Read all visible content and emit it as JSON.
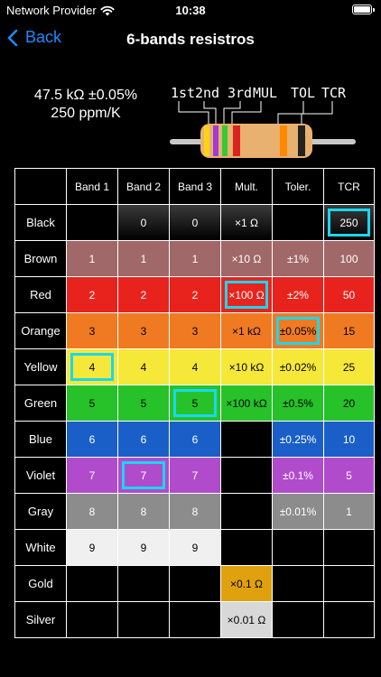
{
  "status": {
    "carrier": "Network Provider",
    "time": "10:38"
  },
  "nav": {
    "back_label": "Back",
    "title": "6-bands resistros"
  },
  "summary": {
    "line1": "47.5 kΩ ±0.05%",
    "line2": "250 ppm/K"
  },
  "diagram": {
    "labels": [
      "1st",
      "2nd",
      "3rd",
      "MUL",
      "TOL",
      "TCR"
    ],
    "bands": [
      "#ffd21a",
      "#a23bd6",
      "#33cc33",
      "#dd2222",
      "#ff8800",
      "#222222"
    ]
  },
  "table": {
    "headers": [
      "",
      "Band 1",
      "Band 2",
      "Band 3",
      "Mult.",
      "Toler.",
      "TCR"
    ],
    "rows": [
      {
        "name": "Black",
        "bg": "#1a1a1a",
        "text": "#ffffff",
        "values": [
          "",
          "0",
          "0",
          "×1 Ω",
          "",
          "250"
        ],
        "filled": [
          false,
          true,
          true,
          true,
          false,
          true
        ],
        "selected": [
          false,
          false,
          false,
          false,
          false,
          true
        ]
      },
      {
        "name": "Brown",
        "bg": "#a06868",
        "text": "#ffffff",
        "values": [
          "1",
          "1",
          "1",
          "×10 Ω",
          "±1%",
          "100"
        ],
        "filled": [
          true,
          true,
          true,
          true,
          true,
          true
        ],
        "selected": [
          false,
          false,
          false,
          false,
          false,
          false
        ]
      },
      {
        "name": "Red",
        "bg": "#e8231e",
        "text": "#ffffff",
        "values": [
          "2",
          "2",
          "2",
          "×100 Ω",
          "±2%",
          "50"
        ],
        "filled": [
          true,
          true,
          true,
          true,
          true,
          true
        ],
        "selected": [
          false,
          false,
          false,
          true,
          false,
          false
        ]
      },
      {
        "name": "Orange",
        "bg": "#f07a22",
        "text": "#000000",
        "values": [
          "3",
          "3",
          "3",
          "×1 kΩ",
          "±0.05%",
          "15"
        ],
        "filled": [
          true,
          true,
          true,
          true,
          true,
          true
        ],
        "selected": [
          false,
          false,
          false,
          false,
          true,
          false
        ]
      },
      {
        "name": "Yellow",
        "bg": "#f5e838",
        "text": "#000000",
        "values": [
          "4",
          "4",
          "4",
          "×10 kΩ",
          "±0.02%",
          "25"
        ],
        "filled": [
          true,
          true,
          true,
          true,
          true,
          true
        ],
        "selected": [
          true,
          false,
          false,
          false,
          false,
          false
        ]
      },
      {
        "name": "Green",
        "bg": "#27c22a",
        "text": "#000000",
        "values": [
          "5",
          "5",
          "5",
          "×100 kΩ",
          "±0.5%",
          "20"
        ],
        "filled": [
          true,
          true,
          true,
          true,
          true,
          true
        ],
        "selected": [
          false,
          false,
          true,
          false,
          false,
          false
        ]
      },
      {
        "name": "Blue",
        "bg": "#1a5fc8",
        "text": "#ffffff",
        "values": [
          "6",
          "6",
          "6",
          "",
          "±0.25%",
          "10"
        ],
        "filled": [
          true,
          true,
          true,
          false,
          true,
          true
        ],
        "selected": [
          false,
          false,
          false,
          false,
          false,
          false
        ]
      },
      {
        "name": "Violet",
        "bg": "#b04ccc",
        "text": "#ffffff",
        "values": [
          "7",
          "7",
          "7",
          "",
          "±0.1%",
          "5"
        ],
        "filled": [
          true,
          true,
          true,
          false,
          true,
          true
        ],
        "selected": [
          false,
          true,
          false,
          false,
          false,
          false
        ]
      },
      {
        "name": "Gray",
        "bg": "#8c8c8c",
        "text": "#ffffff",
        "values": [
          "8",
          "8",
          "8",
          "",
          "±0.01%",
          "1"
        ],
        "filled": [
          true,
          true,
          true,
          false,
          true,
          true
        ],
        "selected": [
          false,
          false,
          false,
          false,
          false,
          false
        ]
      },
      {
        "name": "White",
        "bg": "#f0f0f0",
        "text": "#000000",
        "values": [
          "9",
          "9",
          "9",
          "",
          "",
          ""
        ],
        "filled": [
          true,
          true,
          true,
          false,
          false,
          false
        ],
        "selected": [
          false,
          false,
          false,
          false,
          false,
          false
        ]
      },
      {
        "name": "Gold",
        "bg": "#e0a10e",
        "text": "#000000",
        "values": [
          "",
          "",
          "",
          "×0.1 Ω",
          "",
          ""
        ],
        "filled": [
          false,
          false,
          false,
          true,
          false,
          false
        ],
        "selected": [
          false,
          false,
          false,
          false,
          false,
          false
        ]
      },
      {
        "name": "Silver",
        "bg": "#d8d8d8",
        "text": "#000000",
        "values": [
          "",
          "",
          "",
          "×0.01 Ω",
          "",
          ""
        ],
        "filled": [
          false,
          false,
          false,
          true,
          false,
          false
        ],
        "selected": [
          false,
          false,
          false,
          false,
          false,
          false
        ]
      }
    ],
    "selection_color": "#18d8f0"
  }
}
